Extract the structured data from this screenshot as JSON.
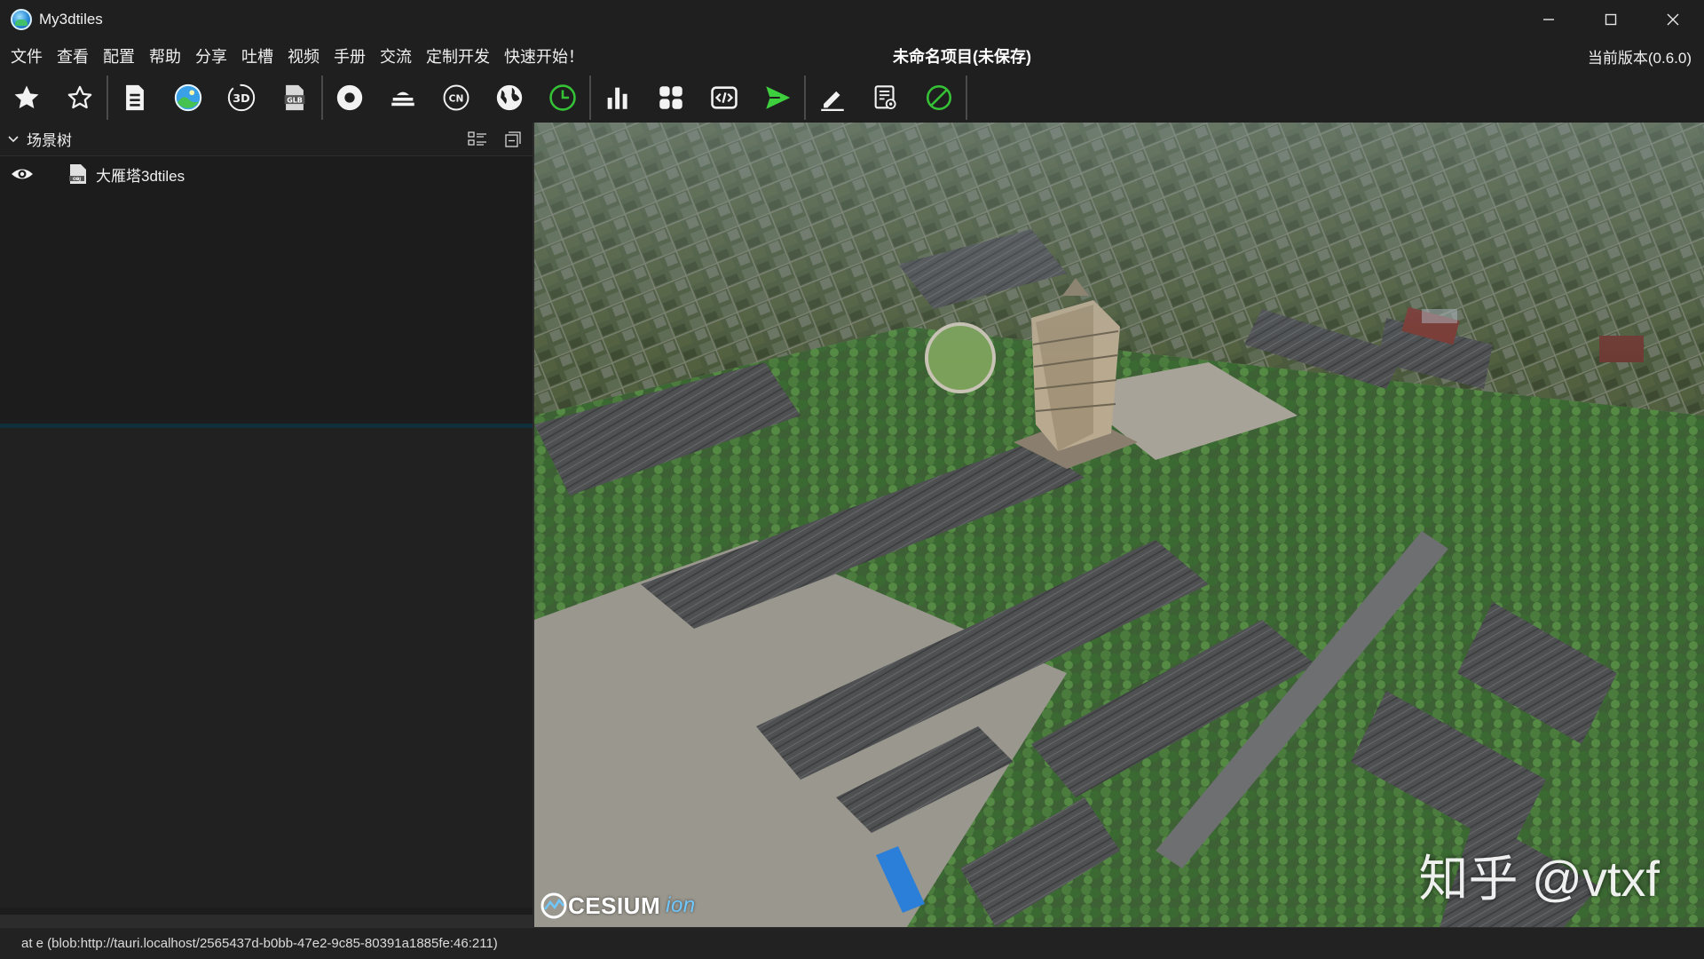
{
  "window": {
    "title": "My3dtiles",
    "controls": {
      "minimize": "—",
      "maximize": "☐",
      "close": "✕"
    }
  },
  "menu": {
    "items": [
      "文件",
      "查看",
      "配置",
      "帮助",
      "分享",
      "吐槽",
      "视频",
      "手册",
      "交流",
      "定制开发",
      "快速开始！"
    ],
    "project_title": "未命名项目(未保存)",
    "version": "当前版本(0.6.0)"
  },
  "toolbar": {
    "buttons": [
      "star-filled-icon",
      "star-outline-icon",
      "document-icon",
      "landscape-icon",
      "cube-3d-icon",
      "glb-icon",
      "record-icon",
      "terrain-icon",
      "cn-icon",
      "globe-icon",
      "clock-icon",
      "bar-chart-icon",
      "grid-icon",
      "code-icon",
      "send-icon",
      "pencil-icon",
      "settings-doc-icon",
      "no-entry-icon"
    ],
    "accent_green": "#3ecf3e"
  },
  "scene_tree": {
    "title": "场景树",
    "items": [
      {
        "label": "大雁塔3dtiles",
        "visible": true
      }
    ]
  },
  "viewport": {
    "logo_text": "CESIUM",
    "logo_suffix": "ion",
    "watermark": "知乎 @vtxf"
  },
  "status": {
    "text": "at e (blob:http://tauri.localhost/2565437d-b0bb-47e2-9c85-80391a1885fe:46:211)"
  }
}
